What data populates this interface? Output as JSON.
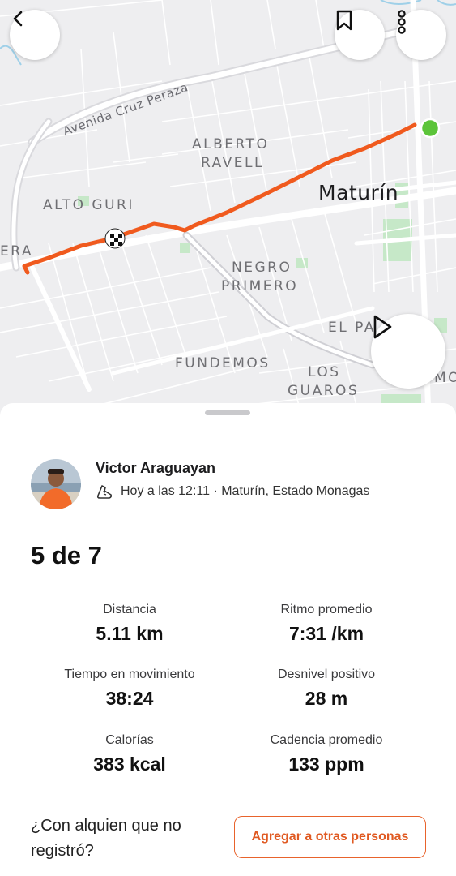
{
  "map": {
    "labels": {
      "street": "Avenida Cruz Peraza",
      "alberto_1": "ALBERTO",
      "alberto_2": "RAVELL",
      "alto_guri": "ALTO GURI",
      "city": "Maturín",
      "era": "ERA",
      "negro_1": "NEGRO",
      "negro_2": "PRIMERO",
      "el_pa": "EL PA",
      "fundemos": "FUNDEMOS",
      "los": "LOS",
      "guaros": "GUAROS",
      "mo": "MO"
    },
    "route_color": "#f05a1e",
    "end_marker_color": "#5cc43a",
    "icons": {
      "back": "chevron-left-icon",
      "bookmark": "bookmark-icon",
      "more": "more-vertical-icon",
      "play": "play-icon"
    }
  },
  "athlete": {
    "name": "Victor Araguayan",
    "meta": "Hoy a las 12:11 · Maturín, Estado Monagas",
    "meta_icon": "shoe-icon"
  },
  "activity": {
    "title": "5 de 7"
  },
  "stats": [
    {
      "label": "Distancia",
      "value": "5.11 km"
    },
    {
      "label": "Ritmo promedio",
      "value": "7:31 /km"
    },
    {
      "label": "Tiempo en movimiento",
      "value": "38:24"
    },
    {
      "label": "Desnivel positivo",
      "value": "28 m"
    },
    {
      "label": "Calorías",
      "value": "383 kcal"
    },
    {
      "label": "Cadencia promedio",
      "value": "133 ppm"
    }
  ],
  "footer": {
    "question": "¿Con alquien que no registró?",
    "button_label": "Agregar a otras personas",
    "accent_color": "#e8632c"
  }
}
